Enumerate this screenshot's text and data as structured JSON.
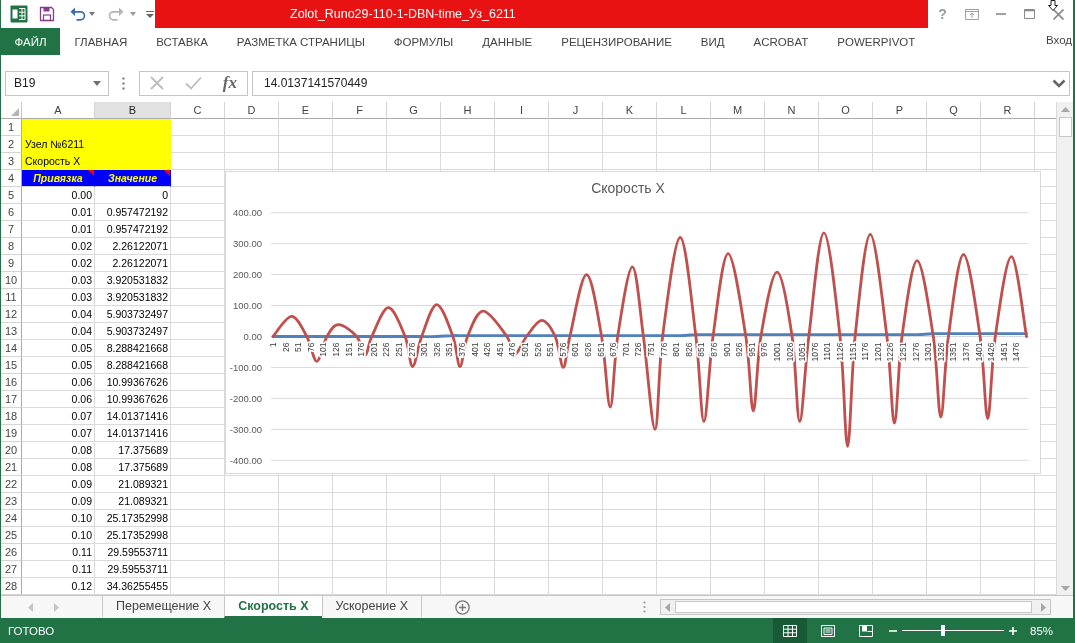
{
  "title_bar": {
    "title": "Zolot_Runo29-110-1-DBN-time_Уз_6211",
    "help": "?"
  },
  "ribbon": {
    "tabs": [
      {
        "label": "ФАЙЛ",
        "kind": "file",
        "selected": false
      },
      {
        "label": "ГЛАВНАЯ",
        "kind": "tab",
        "selected": false
      },
      {
        "label": "ВСТАВКА",
        "kind": "tab",
        "selected": false
      },
      {
        "label": "РАЗМЕТКА СТРАНИЦЫ",
        "kind": "tab",
        "selected": false
      },
      {
        "label": "ФОРМУЛЫ",
        "kind": "tab",
        "selected": false
      },
      {
        "label": "ДАННЫЕ",
        "kind": "tab",
        "selected": false
      },
      {
        "label": "РЕЦЕНЗИРОВАНИЕ",
        "kind": "tab",
        "selected": false
      },
      {
        "label": "ВИД",
        "kind": "tab",
        "selected": false
      },
      {
        "label": "ACROBAT",
        "kind": "tab",
        "selected": false
      },
      {
        "label": "POWERPIVOT",
        "kind": "tab",
        "selected": false
      }
    ],
    "account": "Вход"
  },
  "formula_bar": {
    "name_box": "B19",
    "function_label": "fx",
    "formula": "14.0137141570449"
  },
  "sheet": {
    "columns": [
      {
        "label": "A",
        "selected": false
      },
      {
        "label": "B",
        "selected": true
      },
      {
        "label": "C",
        "selected": false
      },
      {
        "label": "D",
        "selected": false
      },
      {
        "label": "E",
        "selected": false
      },
      {
        "label": "F",
        "selected": false
      },
      {
        "label": "G",
        "selected": false
      },
      {
        "label": "H",
        "selected": false
      },
      {
        "label": "I",
        "selected": false
      },
      {
        "label": "J",
        "selected": false
      },
      {
        "label": "K",
        "selected": false
      },
      {
        "label": "L",
        "selected": false
      },
      {
        "label": "M",
        "selected": false
      },
      {
        "label": "N",
        "selected": false
      },
      {
        "label": "O",
        "selected": false
      },
      {
        "label": "P",
        "selected": false
      },
      {
        "label": "Q",
        "selected": false
      },
      {
        "label": "R",
        "selected": false
      }
    ],
    "rows": [
      {
        "header": "1",
        "kind": "title"
      },
      {
        "header": "2",
        "kind": "title",
        "a": "Узел №6211"
      },
      {
        "header": "3",
        "kind": "title",
        "a": "Скорость X"
      },
      {
        "header": "4",
        "kind": "heading",
        "a": "Привязка",
        "b": "Значение"
      },
      {
        "header": "5",
        "kind": "data",
        "a": "0.00",
        "b": "0"
      },
      {
        "header": "6",
        "kind": "data",
        "a": "0.01",
        "b": "0.957472192"
      },
      {
        "header": "7",
        "kind": "data",
        "a": "0.01",
        "b": "0.957472192"
      },
      {
        "header": "8",
        "kind": "data",
        "a": "0.02",
        "b": "2.26122071"
      },
      {
        "header": "9",
        "kind": "data",
        "a": "0.02",
        "b": "2.26122071"
      },
      {
        "header": "10",
        "kind": "data",
        "a": "0.03",
        "b": "3.920531832"
      },
      {
        "header": "11",
        "kind": "data",
        "a": "0.03",
        "b": "3.920531832"
      },
      {
        "header": "12",
        "kind": "data",
        "a": "0.04",
        "b": "5.903732497"
      },
      {
        "header": "13",
        "kind": "data",
        "a": "0.04",
        "b": "5.903732497"
      },
      {
        "header": "14",
        "kind": "data",
        "a": "0.05",
        "b": "8.288421668"
      },
      {
        "header": "15",
        "kind": "data",
        "a": "0.05",
        "b": "8.288421668"
      },
      {
        "header": "16",
        "kind": "data",
        "a": "0.06",
        "b": "10.99367626"
      },
      {
        "header": "17",
        "kind": "data",
        "a": "0.06",
        "b": "10.99367626"
      },
      {
        "header": "18",
        "kind": "data",
        "a": "0.07",
        "b": "14.01371416"
      },
      {
        "header": "19",
        "kind": "data",
        "a": "0.07",
        "b": "14.01371416"
      },
      {
        "header": "20",
        "kind": "data",
        "a": "0.08",
        "b": "17.375689"
      },
      {
        "header": "21",
        "kind": "data",
        "a": "0.08",
        "b": "17.375689"
      },
      {
        "header": "22",
        "kind": "data",
        "a": "0.09",
        "b": "21.089321"
      },
      {
        "header": "23",
        "kind": "data",
        "a": "0.09",
        "b": "21.089321"
      },
      {
        "header": "24",
        "kind": "data",
        "a": "0.10",
        "b": "25.17352998"
      },
      {
        "header": "25",
        "kind": "data",
        "a": "0.10",
        "b": "25.17352998"
      },
      {
        "header": "26",
        "kind": "data",
        "a": "0.11",
        "b": "29.59553711"
      },
      {
        "header": "27",
        "kind": "data",
        "a": "0.11",
        "b": "29.59553711"
      },
      {
        "header": "28",
        "kind": "data",
        "a": "0.12",
        "b": "34.36255455"
      }
    ]
  },
  "chart": {
    "chart_data": {
      "type": "line",
      "title": "Скорость X",
      "grid": true,
      "x": [
        1,
        38,
        68,
        88,
        108,
        131,
        167,
        184,
        197,
        230,
        263,
        278,
        296,
        326,
        358,
        372,
        387,
        418,
        465,
        480,
        504,
        534,
        561,
        577,
        590,
        623,
        653,
        670,
        685,
        714,
        736,
        759,
        774,
        809,
        840,
        856,
        874,
        904,
        939,
        954,
        969,
        1001,
        1031,
        1046,
        1064,
        1094,
        1126,
        1141,
        1156,
        1186,
        1219,
        1234,
        1249,
        1279,
        1311,
        1326,
        1341,
        1371,
        1404,
        1419,
        1434,
        1466,
        1496
      ],
      "series": [
        {
          "color": "#4f81bd",
          "values": [
            0,
            0,
            0,
            0,
            0,
            0,
            0,
            0,
            0,
            0,
            0,
            0,
            0,
            0,
            3,
            3,
            3,
            3,
            3,
            3,
            3,
            3,
            3,
            3,
            3,
            3,
            3,
            3,
            3,
            3,
            3,
            3,
            3,
            3,
            6,
            6,
            6,
            6,
            6,
            6,
            6,
            6,
            6,
            6,
            6,
            6,
            6,
            6,
            6,
            6,
            6,
            6,
            6,
            6,
            9,
            9,
            9,
            9,
            9,
            9,
            9,
            9,
            9
          ]
        },
        {
          "color": "#c0504d",
          "values": [
            0,
            65,
            0,
            -80,
            0,
            38,
            0,
            -60,
            0,
            93,
            0,
            -97,
            0,
            103,
            0,
            -97,
            0,
            82,
            0,
            -60,
            0,
            52,
            0,
            -100,
            0,
            200,
            0,
            -228,
            0,
            225,
            0,
            -300,
            0,
            320,
            0,
            -275,
            0,
            268,
            0,
            -240,
            0,
            208,
            0,
            -275,
            0,
            335,
            0,
            -355,
            0,
            330,
            0,
            -280,
            0,
            245,
            0,
            -260,
            0,
            265,
            0,
            -265,
            0,
            258,
            0
          ]
        }
      ],
      "xlim": [
        1,
        1496
      ],
      "ylim": [
        -400,
        400
      ],
      "xticks": [
        1,
        26,
        51,
        76,
        101,
        126,
        151,
        176,
        201,
        226,
        251,
        276,
        301,
        326,
        351,
        376,
        401,
        426,
        451,
        476,
        501,
        526,
        551,
        576,
        601,
        626,
        651,
        676,
        701,
        726,
        751,
        776,
        801,
        826,
        851,
        876,
        901,
        926,
        951,
        976,
        1001,
        1026,
        1051,
        1076,
        1101,
        1126,
        1151,
        1176,
        1201,
        1226,
        1251,
        1276,
        1301,
        1326,
        1351,
        1376,
        1401,
        1426,
        1451,
        1476
      ],
      "yticks": [
        {
          "value": 400,
          "label": "400.00"
        },
        {
          "value": 300,
          "label": "300.00"
        },
        {
          "value": 200,
          "label": "200.00"
        },
        {
          "value": 100,
          "label": "100.00"
        },
        {
          "value": 0,
          "label": "0.00"
        },
        {
          "value": -100,
          "label": "-100.00"
        },
        {
          "value": -200,
          "label": "-200.00"
        },
        {
          "value": -300,
          "label": "-300.00"
        },
        {
          "value": -400,
          "label": "-400.00"
        }
      ]
    }
  },
  "sheet_tabs": [
    {
      "label": "Перемещение X",
      "selected": false
    },
    {
      "label": "Скорость X",
      "selected": true
    },
    {
      "label": "Ускорение X",
      "selected": false
    }
  ],
  "status_bar": {
    "status": "ГОТОВО",
    "views": [
      {
        "kind": "normal",
        "selected": true
      },
      {
        "kind": "page_layout",
        "selected": false
      },
      {
        "kind": "page_break",
        "selected": false
      }
    ],
    "zoom": {
      "level": 0.4,
      "reading": "85%"
    }
  }
}
